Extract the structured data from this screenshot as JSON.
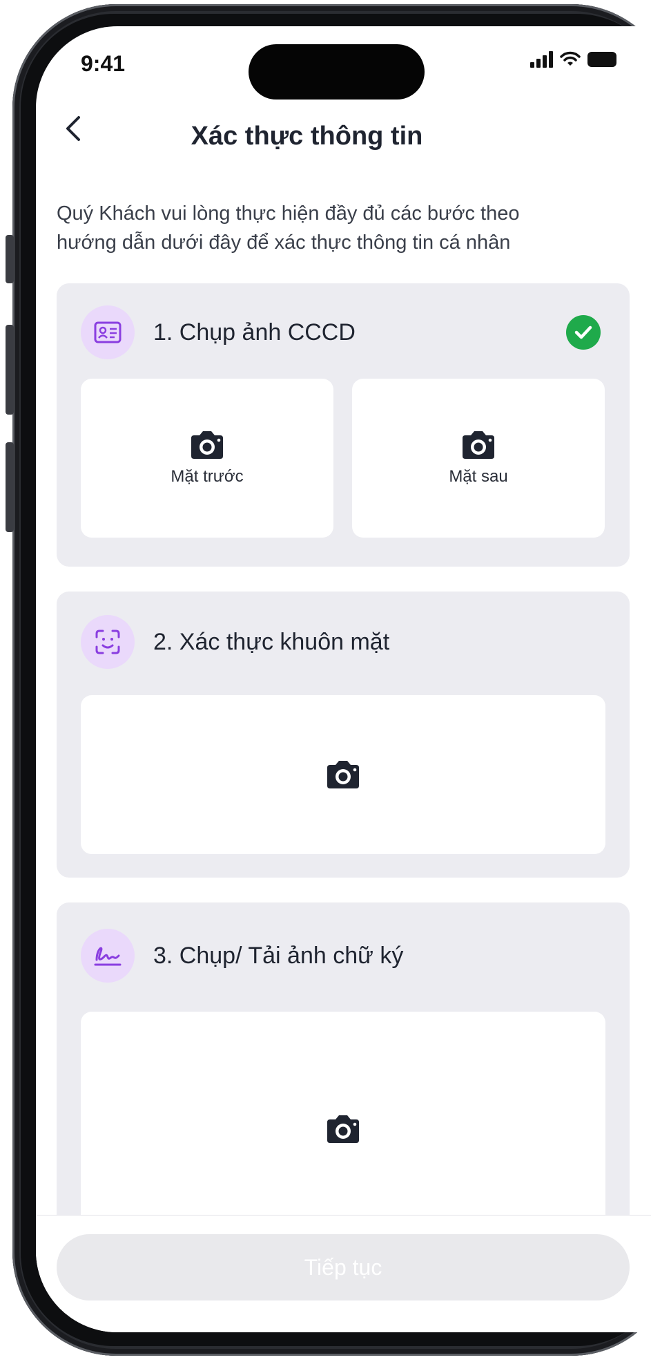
{
  "status": {
    "time": "9:41"
  },
  "header": {
    "title": "Xác thực thông tin",
    "back_icon": "chevron-left-icon"
  },
  "intro": "Quý Khách vui lòng thực hiện đầy đủ các bước theo hướng dẫn dưới đây để xác thực thông tin cá nhân",
  "steps": [
    {
      "title": "1. Chụp ảnh CCCD",
      "icon": "id-card-icon",
      "completed": true,
      "slots": [
        {
          "label": "Mặt trước",
          "icon": "camera-icon"
        },
        {
          "label": "Mặt sau",
          "icon": "camera-icon"
        }
      ]
    },
    {
      "title": "2. Xác thực khuôn mặt",
      "icon": "face-scan-icon",
      "completed": false,
      "slots": [
        {
          "label": "",
          "icon": "camera-icon"
        }
      ]
    },
    {
      "title": "3. Chụp/ Tải ảnh chữ ký",
      "icon": "signature-icon",
      "completed": false,
      "slots": [
        {
          "label": "",
          "icon": "camera-icon"
        }
      ]
    }
  ],
  "footer": {
    "continue_label": "Tiếp tục",
    "continue_enabled": false
  },
  "colors": {
    "accent_bg": "#ead9fb",
    "accent_icon": "#8a3ee0",
    "success": "#1faa4b",
    "card_bg": "#ececf1",
    "disabled_button": "#e9e9ec"
  }
}
